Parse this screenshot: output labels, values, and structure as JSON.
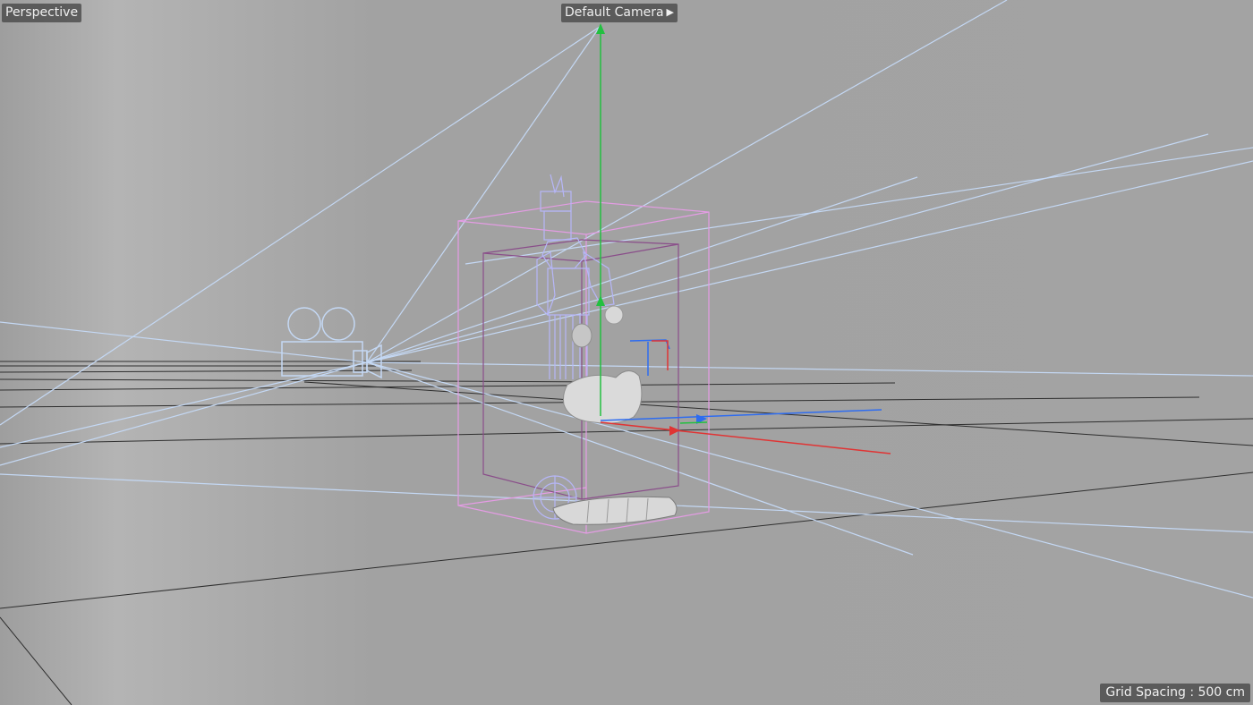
{
  "viewport": {
    "view_name": "Perspective",
    "camera": "Default Camera",
    "camera_icon": "camera-icon",
    "grid_spacing_label": "Grid Spacing : 500 cm"
  },
  "colors": {
    "background": "#a3a3a3",
    "grid_line": "#2e2e2e",
    "camera_wire": "#c4d8f4",
    "character_wire": "#b6b6f8",
    "bounding_box": "#e49ce4",
    "axis_x": "#e03434",
    "axis_y": "#22c040",
    "axis_z": "#2e6cf0",
    "mesh": "#d4d4d4"
  }
}
